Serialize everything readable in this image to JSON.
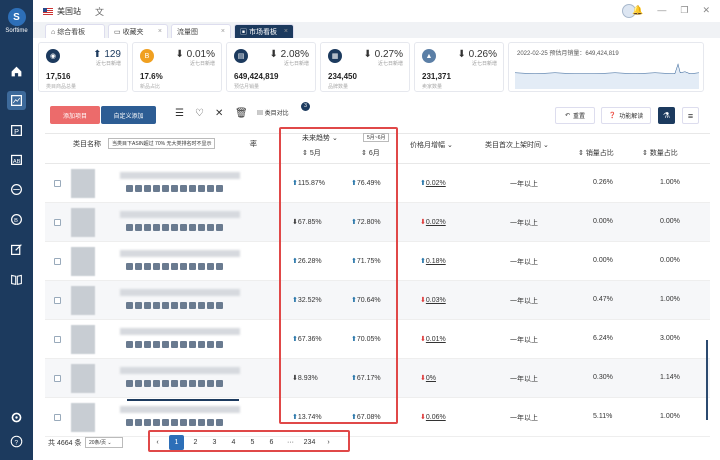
{
  "app": {
    "name": "Sorftime",
    "site": "美国站"
  },
  "tabs": [
    {
      "label": "综合看板"
    },
    {
      "label": "收藏夹"
    },
    {
      "label": "流量图"
    },
    {
      "label": "市场看板"
    }
  ],
  "stats": [
    {
      "change": "129",
      "sub": "近七日新增",
      "value": "17,516",
      "label": "类目商品总量"
    },
    {
      "change": "0.01%",
      "sub": "近七日新增",
      "value": "17.6%",
      "label": "新品占比"
    },
    {
      "change": "2.08%",
      "sub": "近七日新增",
      "value": "649,424,819",
      "label": "预估月销量"
    },
    {
      "change": "0.27%",
      "sub": "近七日新增",
      "value": "234,450",
      "label": "品牌数量"
    },
    {
      "change": "0.26%",
      "sub": "近七日新增",
      "value": "231,371",
      "label": "卖家数量"
    }
  ],
  "sparkline": {
    "title": "2022-02-25 预估月销量：649,424,819"
  },
  "toolbar": {
    "add_label": "添加项目",
    "custom_label": "自定义添加",
    "compare_label": "类目对比",
    "compare_badge": "3",
    "reset_label": "重置",
    "help_label": "功能解读"
  },
  "table": {
    "headers": {
      "name": "类目名称",
      "filter_note": "当类目下ASIN超过 70% 无大类排名时不显示",
      "rate": "率",
      "trend": "未来趋势",
      "trend_range": "5月~6月",
      "may": "5月",
      "jun": "6月",
      "price_growth": "价格月增幅",
      "first_listed": "类目首次上架时间",
      "sales_share": "销量占比",
      "qty_share": "数量占比"
    },
    "rows": [
      {
        "may": "115.87%",
        "may_dir": "up",
        "jun": "76.49%",
        "jun_dir": "up",
        "price": "0.02%",
        "price_dir": "up",
        "listed": "一年以上",
        "sales": "0.26%",
        "qty": "1.00%"
      },
      {
        "may": "67.85%",
        "may_dir": "down",
        "jun": "72.80%",
        "jun_dir": "up",
        "price": "0.02%",
        "price_dir": "down",
        "listed": "一年以上",
        "sales": "0.00%",
        "qty": "0.00%"
      },
      {
        "may": "26.28%",
        "may_dir": "up",
        "jun": "71.75%",
        "jun_dir": "up",
        "price": "0.18%",
        "price_dir": "up",
        "listed": "一年以上",
        "sales": "0.00%",
        "qty": "0.00%"
      },
      {
        "may": "32.52%",
        "may_dir": "up",
        "jun": "70.64%",
        "jun_dir": "up",
        "price": "0.03%",
        "price_dir": "down",
        "listed": "一年以上",
        "sales": "0.47%",
        "qty": "1.00%"
      },
      {
        "may": "67.36%",
        "may_dir": "up",
        "jun": "70.05%",
        "jun_dir": "up",
        "price": "0.01%",
        "price_dir": "down",
        "listed": "一年以上",
        "sales": "6.24%",
        "qty": "3.00%"
      },
      {
        "may": "8.93%",
        "may_dir": "down",
        "jun": "67.17%",
        "jun_dir": "up",
        "price": "0%",
        "price_dir": "down",
        "listed": "一年以上",
        "sales": "0.30%",
        "qty": "1.14%"
      },
      {
        "may": "13.74%",
        "may_dir": "up",
        "jun": "67.08%",
        "jun_dir": "up",
        "price": "0.06%",
        "price_dir": "down",
        "listed": "一年以上",
        "sales": "5.11%",
        "qty": "1.00%"
      }
    ]
  },
  "pager": {
    "total": "共 4664 条",
    "size": "20条/页",
    "pages": [
      "1",
      "2",
      "3",
      "4",
      "5",
      "6",
      "···",
      "234"
    ],
    "current": "1"
  },
  "colors": {
    "sidebar": "#1c3a5e",
    "accent": "#2d6fb8",
    "up": "#1d6fa5",
    "down": "#d33333",
    "highlight": "#e04848"
  }
}
